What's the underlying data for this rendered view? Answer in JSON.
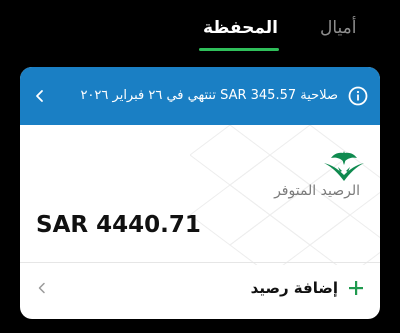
{
  "tabs": {
    "items": [
      {
        "label": "أميال",
        "active": false
      },
      {
        "label": "المحفظة",
        "active": true
      }
    ]
  },
  "card": {
    "banner": {
      "text": "صلاحية SAR 345.57 تنتهي في ٢٦ فبراير ٢٠٢٦",
      "icon": "info-icon",
      "action_icon": "chevron-left-icon"
    },
    "logo": "saudia-logo",
    "balance": {
      "label": "الرصيد المتوفر",
      "value": "SAR 4440.71"
    },
    "add_balance": {
      "label": "إضافة رصيد",
      "icon": "plus-icon",
      "action_icon": "chevron-left-icon"
    }
  },
  "colors": {
    "accent": "#2fbf5a",
    "banner": "#1a7fc4",
    "background": "#000000"
  }
}
